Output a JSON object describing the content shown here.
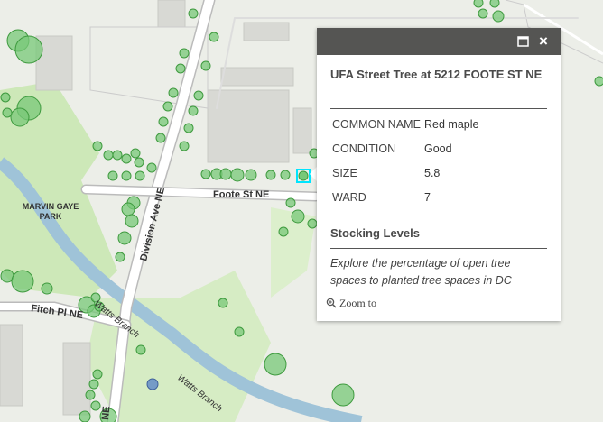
{
  "map": {
    "labels": {
      "park": "MARVIN GAYE\nPARK",
      "park_line1": "MARVIN GAYE",
      "park_line2": "PARK",
      "division_ave": "Division Ave NE",
      "division_ave_bottom": "NE",
      "foote_st": "Foote St NE",
      "fitch_pl": "Fitch Pl NE",
      "watts_branch_1": "Watts Branch",
      "watts_branch_2": "Watts Branch"
    },
    "colors": {
      "tree_fill": "#78c878",
      "tree_stroke": "#3e9a3e",
      "selected_highlight": "#00e5ff",
      "stream": "#9fc3d8",
      "park": "#cde8b8",
      "road": "#ffffff"
    }
  },
  "popup": {
    "maximize_icon": "maximize-icon",
    "close_label": "×",
    "title": "UFA Street Tree at 5212 FOOTE ST NE",
    "attributes": [
      {
        "key": "COMMON NAME",
        "value": "Red maple"
      },
      {
        "key": "CONDITION",
        "value": "Good"
      },
      {
        "key": "SIZE",
        "value": "5.8"
      },
      {
        "key": "WARD",
        "value": "7"
      }
    ],
    "section_title": "Stocking Levels",
    "section_description": "Explore the percentage of open tree spaces to planted tree spaces in DC",
    "zoom_label": "Zoom to"
  }
}
